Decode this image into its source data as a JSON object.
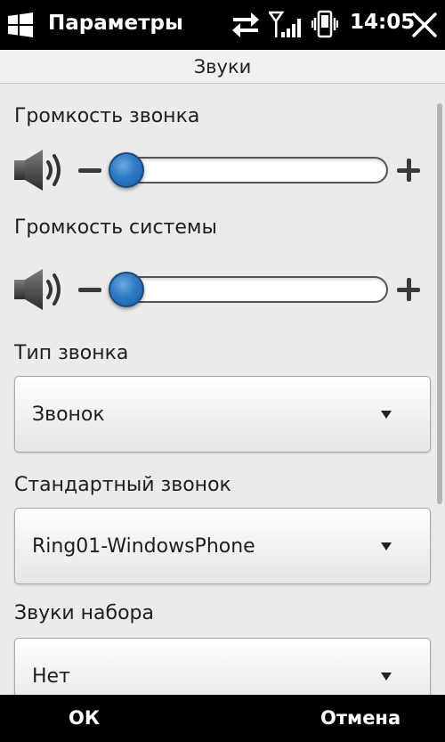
{
  "titlebar": {
    "start_icon": "windows-logo-icon",
    "title": "Параметры",
    "time": "14:05",
    "status_icons": [
      "sync-arrows-icon",
      "signal-strength-icon",
      "phone-vibrate-icon"
    ],
    "close_icon": "close-icon"
  },
  "section": {
    "title": "Звуки"
  },
  "settings": {
    "ring_volume": {
      "label": "Громкость звонка",
      "icon": "speaker-icon",
      "level": 0.0
    },
    "system_volume": {
      "label": "Громкость системы",
      "icon": "speaker-icon",
      "level": 0.0
    },
    "ring_type": {
      "label": "Тип звонка",
      "value": "Звонок"
    },
    "ringtone": {
      "label": "Стандартный звонок",
      "value": "Ring01-WindowsPhone"
    },
    "keypad": {
      "label": "Звуки набора",
      "value": "Нет"
    }
  },
  "softkeys": {
    "left": "ОК",
    "right": "Отмена"
  },
  "colors": {
    "titlebar_bg": "#000000",
    "content_bg": "#ebebeb",
    "slider_thumb": "#2f7ac4",
    "text": "#1e1e1e"
  }
}
